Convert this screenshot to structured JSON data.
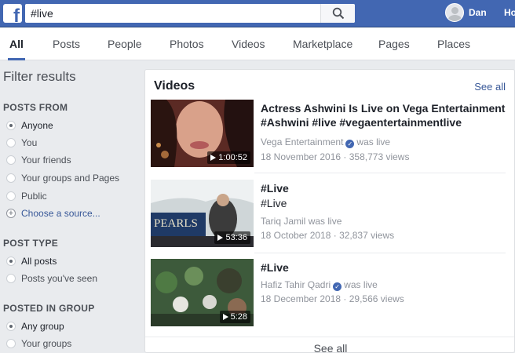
{
  "header": {
    "logo_letter": "f",
    "search_value": "#live",
    "user_name": "Dan",
    "home_label": "Ho",
    "brand_color": "#4267b2"
  },
  "tabs": [
    {
      "label": "All",
      "active": true
    },
    {
      "label": "Posts"
    },
    {
      "label": "People"
    },
    {
      "label": "Photos"
    },
    {
      "label": "Videos"
    },
    {
      "label": "Marketplace"
    },
    {
      "label": "Pages"
    },
    {
      "label": "Places"
    }
  ],
  "sidebar": {
    "title": "Filter results",
    "posts_from": {
      "heading": "POSTS FROM",
      "options": [
        "Anyone",
        "You",
        "Your friends",
        "Your groups and Pages",
        "Public"
      ],
      "selected": "Anyone",
      "choose_source": "Choose a source..."
    },
    "post_type": {
      "heading": "POST TYPE",
      "options": [
        "All posts",
        "Posts you've seen"
      ],
      "selected": "All posts"
    },
    "posted_in_group": {
      "heading": "POSTED IN GROUP",
      "options": [
        "Any group",
        "Your groups"
      ],
      "selected": "Any group"
    }
  },
  "videos": {
    "title": "Videos",
    "see_all_top": "See all",
    "see_all_bottom": "See all",
    "results": [
      {
        "title_line1": "Actress Ashwini Is Live on Vega Entertainment",
        "title_line2": "#Ashwini #live #vegaentertainmentlive",
        "author": "Vega Entertainment",
        "verified": true,
        "status": "was live",
        "date": "18 November 2016",
        "views": "358,773 views",
        "duration": "1:00:52"
      },
      {
        "title_line1": "#Live",
        "subtitle": "#Live",
        "author": "Tariq Jamil",
        "verified": false,
        "status": "was live",
        "date": "18 October 2018",
        "views": "32,837 views",
        "duration": "53:36"
      },
      {
        "title_line1": "#Live",
        "author": "Hafiz Tahir Qadri",
        "verified": true,
        "status": "was live",
        "date": "18 December 2018",
        "views": "29,566 views",
        "duration": "5:28"
      }
    ]
  }
}
